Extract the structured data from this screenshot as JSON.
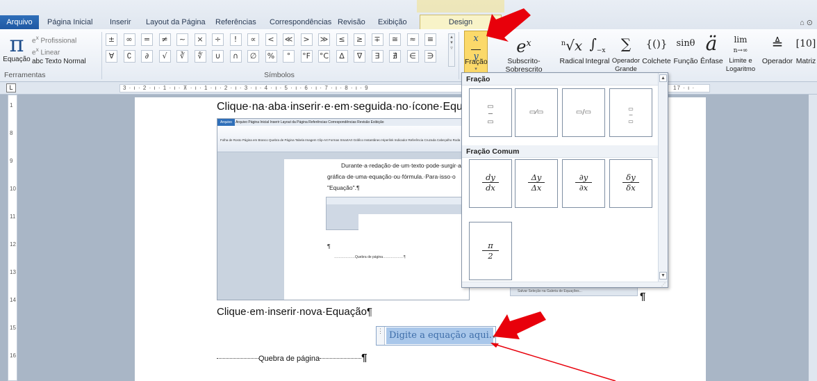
{
  "tabs": {
    "file": "Arquivo",
    "items": [
      "Página Inicial",
      "Inserir",
      "Layout da Página",
      "Referências",
      "Correspondências",
      "Revisão",
      "Exibição"
    ],
    "design": "Design"
  },
  "ribbon": {
    "equation": {
      "label": "Equação",
      "professional": "Profissional",
      "linear": "Linear",
      "normal_text": "Texto Normal",
      "group": "Ferramentas"
    },
    "symbols": {
      "group": "Símbolos",
      "row1": [
        "±",
        "∞",
        "=",
        "≠",
        "~",
        "×",
        "÷",
        "!",
        "∝",
        "<",
        "≪",
        ">",
        "≫",
        "≤",
        "≥",
        "∓",
        "≅",
        "≈",
        "≡"
      ],
      "row2": [
        "∀",
        "∁",
        "∂",
        "√",
        "∛",
        "∜",
        "∪",
        "∩",
        "∅",
        "%",
        "°",
        "°F",
        "°C",
        "∆",
        "∇",
        "∃",
        "∄",
        "∈",
        "∋"
      ]
    },
    "structures": [
      {
        "label": "Fração",
        "glyph": "x/y"
      },
      {
        "label": "Subscrito-Sobrescrito",
        "glyph": "eˣ"
      },
      {
        "label": "Radical",
        "glyph": "ⁿ√x"
      },
      {
        "label": "Integral",
        "glyph": "∫"
      },
      {
        "label": "Operador Grande",
        "glyph": "∑"
      },
      {
        "label": "Colchete",
        "glyph": "{()}"
      },
      {
        "label": "Função",
        "glyph": "sinθ"
      },
      {
        "label": "Ênfase",
        "glyph": "ä"
      },
      {
        "label": "Limite e Logaritmo",
        "glyph": "lim"
      },
      {
        "label": "Operador",
        "glyph": "≜"
      },
      {
        "label": "Matriz",
        "glyph": "[10]"
      }
    ]
  },
  "ruler": {
    "corner": "L",
    "ticks": "3 · ı · 2 · ı · 1 · ı · ⊼ · ı · 1 · ı · 2 · ı · 3 · ı · 4 · ı · 5 · ı · 6 · ı · 7 · ı · 8 · ı · 9",
    "ticks_right": "17 · ı ·",
    "vticks": [
      "1",
      "8",
      "9",
      "10",
      "11",
      "12",
      "13",
      "14",
      "15",
      "16"
    ]
  },
  "document": {
    "line1": "Clique·na·aba·inserir·e·em·seguida·no·ícone·Equ",
    "line2": "Clique·em·inserir·nova·Equação¶",
    "page_break": "Quebra de página",
    "pilcrow": "¶",
    "equation_placeholder": "Digite a equação aqui."
  },
  "embedded": {
    "tabs": "Arquivo   Página Inicial   Inserir   Layout da Página   Referências   Correspondências   Revisão   Exibição",
    "ribbon": "Folha de Rosto  Página em Branco  Quebra de Página   Tabela   Imagem  Clip-Art  Formas  SmartArt  Gráfico  Instantâneo   Hiperlink  Indicador  Referência Cruzada   Cabeçalho  Roda",
    "text1": "Durante·a·redação·de·um·texto·pode·surgir·a",
    "text2": "gráfica·de·uma·equação·ou·fórmula.·Para·isso·o",
    "text3": "\"Equação\".¶",
    "pilcrow": "¶",
    "page_break": "Quebra de página",
    "fragment": "Salvar Seleção na Galeria de Equações..."
  },
  "gallery": {
    "section1": "Fração",
    "section2": "Fração Comum",
    "common": [
      {
        "num": "dy",
        "den": "dx"
      },
      {
        "num": "Δy",
        "den": "Δx"
      },
      {
        "num": "∂y",
        "den": "∂x"
      },
      {
        "num": "δy",
        "den": "δx"
      },
      {
        "num": "π",
        "den": "2"
      }
    ],
    "fraction_styles": [
      "⬚/⬚ stacked",
      "⬚/⬚ skewed",
      "⬚/⬚ linear",
      "⬚/⬚ small"
    ]
  },
  "colors": {
    "accent": "#1f58a3",
    "highlight": "#fbd96a",
    "arrow_red": "#e8000b",
    "placeholder_bg": "#a9c7ea"
  }
}
